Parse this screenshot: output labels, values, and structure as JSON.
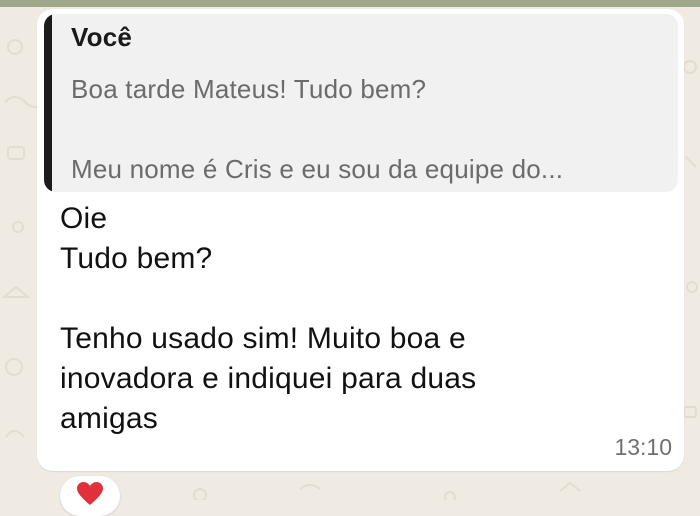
{
  "message": {
    "quoted": {
      "author": "Você",
      "text": "Boa tarde Mateus! Tudo bem?\n\nMeu nome é Cris e eu sou da equipe do..."
    },
    "text": "Oie\nTudo bem?\n\nTenho usado sim! Muito boa e\ninovadora e indiquei para duas\namigas",
    "time": "13:10",
    "reaction": "heart"
  },
  "colors": {
    "background": "#efeae2",
    "bubble": "#ffffff",
    "quote_background": "#f1f1f1",
    "quote_bar": "#1b1b1b",
    "heart": "#e0303a"
  }
}
